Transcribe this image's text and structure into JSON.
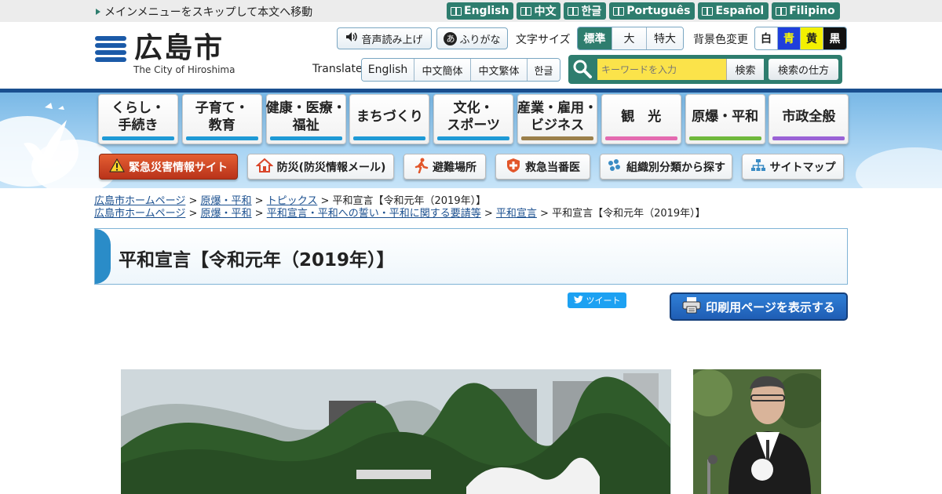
{
  "topbar": {
    "skip": "メインメニューをスキップして本文へ移動",
    "languages": [
      "English",
      "中文",
      "한글",
      "Português",
      "Español",
      "Filipino"
    ]
  },
  "logo": {
    "name": "広島市",
    "sub": "The City of Hiroshima"
  },
  "tools": {
    "voice": "音声読み上げ",
    "furigana": "ふりがな",
    "font_size_label": "文字サイズ",
    "font_sizes": [
      "標準",
      "大",
      "特大"
    ],
    "bg_label": "背景色変更",
    "bg_colors": [
      {
        "label": "白",
        "bg": "#ffffff",
        "fg": "#222222"
      },
      {
        "label": "青",
        "bg": "#1f3fdc",
        "fg": "#ffff00"
      },
      {
        "label": "黄",
        "bg": "#f3f000",
        "fg": "#222222"
      },
      {
        "label": "黒",
        "bg": "#111111",
        "fg": "#ffffff"
      }
    ],
    "translate_label": "Translate",
    "translate": [
      "English",
      "中文簡体",
      "中文繁体",
      "한글"
    ]
  },
  "search": {
    "placeholder": "キーワードを入力",
    "button": "検索",
    "help": "検索の仕方"
  },
  "global_nav": [
    {
      "label": "くらし・\n手続き",
      "color": "#1e9ad6"
    },
    {
      "label": "子育て・\n教育",
      "color": "#1e9ad6"
    },
    {
      "label": "健康・医療・\n福祉",
      "color": "#1e9ad6"
    },
    {
      "label": "まちづくり",
      "color": "#1e9ad6"
    },
    {
      "label": "文化・\nスポーツ",
      "color": "#1e9ad6"
    },
    {
      "label": "産業・雇用・\nビジネス",
      "color": "#9b7f4a"
    },
    {
      "label": "観　光",
      "color": "#e46ab0"
    },
    {
      "label": "原爆・平和",
      "color": "#6fb83c"
    },
    {
      "label": "市政全般",
      "color": "#9a62d6"
    }
  ],
  "sub_nav": {
    "emergency": "緊急災害情報サイト",
    "bousai": "防災(防災情報メール)",
    "hinan": "避難場所",
    "kyukyu": "救急当番医",
    "soshiki": "組織別分類から探す",
    "sitemap": "サイトマップ"
  },
  "breadcrumbs": [
    {
      "links": [
        "広島市ホームページ",
        "原爆・平和",
        "トピックス"
      ],
      "current": "平和宣言【令和元年（2019年）】"
    },
    {
      "links": [
        "広島市ホームページ",
        "原爆・平和",
        "平和宣言・平和への誓い・平和に関する要請等",
        "平和宣言"
      ],
      "current": "平和宣言【令和元年（2019年）】"
    }
  ],
  "page": {
    "title": "平和宣言【令和元年（2019年）】",
    "tweet": "ツイート",
    "print": "印刷用ページを表示する"
  }
}
